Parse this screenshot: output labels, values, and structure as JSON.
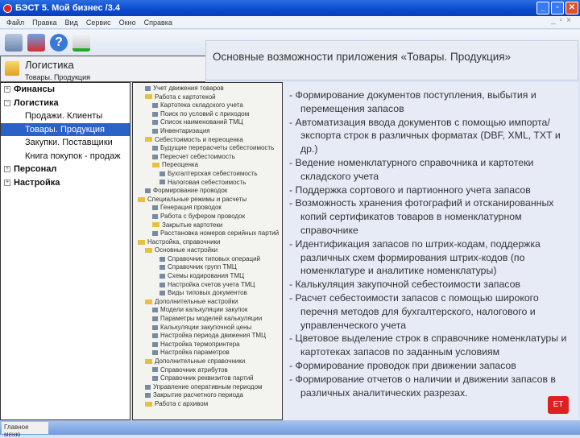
{
  "window": {
    "title": "БЭСТ 5. Мой бизнес /3.4",
    "buttons": [
      "_",
      "▫",
      "✕"
    ]
  },
  "menu": [
    "Файл",
    "Правка",
    "Вид",
    "Сервис",
    "Окно",
    "Справка"
  ],
  "callout": "Основные возможности приложения «Товары. Продукция»",
  "module": {
    "title": "Логистика",
    "subtitle": "Товары. Продукция"
  },
  "nav": [
    {
      "label": "Финансы",
      "level": 0,
      "pm": "+"
    },
    {
      "label": "Логистика",
      "level": 0,
      "pm": "−"
    },
    {
      "label": "Продажи. Клиенты",
      "level": 1
    },
    {
      "label": "Товары. Продукция",
      "level": 1,
      "selected": true
    },
    {
      "label": "Закупки. Поставщики",
      "level": 1
    },
    {
      "label": "Книга покупок - продаж",
      "level": 1
    },
    {
      "label": "Персонал",
      "level": 0,
      "pm": "+"
    },
    {
      "label": "Настройка",
      "level": 0,
      "pm": "+"
    }
  ],
  "tree": [
    {
      "t": "Учет движения товаров",
      "l": 1
    },
    {
      "t": "Работа с картотекой",
      "l": 1,
      "f": 1
    },
    {
      "t": "Картотека складского учета",
      "l": 2
    },
    {
      "t": "Поиск по условий с приходом",
      "l": 2
    },
    {
      "t": "Список наименований ТМЦ",
      "l": 2
    },
    {
      "t": "Инвентаризация",
      "l": 2
    },
    {
      "t": "Себестоимость и переоценка",
      "l": 1,
      "f": 1
    },
    {
      "t": "Будущие перерасчеты себестоимость",
      "l": 2
    },
    {
      "t": "Пересчет себестоимость",
      "l": 2
    },
    {
      "t": "Переоценка",
      "l": 2,
      "f": 1
    },
    {
      "t": "Бухгалтерская себестоимость",
      "l": 3
    },
    {
      "t": "Налоговая себестоимость",
      "l": 3
    },
    {
      "t": "Формирование проводок",
      "l": 1
    },
    {
      "t": "Специальные режимы и расчеты",
      "l": 0,
      "f": 1
    },
    {
      "t": "Генерация проводок",
      "l": 2
    },
    {
      "t": "Работа с буфером проводок",
      "l": 2
    },
    {
      "t": "Закрытые картотеки",
      "l": 2,
      "f": 1
    },
    {
      "t": "Расстановка номеров серийных партий",
      "l": 2
    },
    {
      "t": "Настройка, справочники",
      "l": 0,
      "f": 1
    },
    {
      "t": "Основные настройки",
      "l": 1,
      "f": 1
    },
    {
      "t": "Справочник типовых операций",
      "l": 3
    },
    {
      "t": "Справочник групп ТМЦ",
      "l": 3
    },
    {
      "t": "Схемы кодирования ТМЦ",
      "l": 3
    },
    {
      "t": "Настройка счетов учета ТМЦ",
      "l": 3
    },
    {
      "t": "Виды типовых документов",
      "l": 3
    },
    {
      "t": "Дополнительные настройки",
      "l": 1,
      "f": 1
    },
    {
      "t": "Модели калькуляции закупок",
      "l": 2
    },
    {
      "t": "Параметры моделей калькуляции",
      "l": 2
    },
    {
      "t": "Калькуляции закупочной цены",
      "l": 2
    },
    {
      "t": "Настройка периода движения ТМЦ",
      "l": 2
    },
    {
      "t": "Настройка термопринтера",
      "l": 2
    },
    {
      "t": "Настройка параметров",
      "l": 2
    },
    {
      "t": "Дополнительные справочники",
      "l": 1,
      "f": 1
    },
    {
      "t": "Справочник атрибутов",
      "l": 2
    },
    {
      "t": "Справочник реквизитов партий",
      "l": 2
    },
    {
      "t": "Управление оперативным периодом",
      "l": 1
    },
    {
      "t": "Закрытие расчетного периода",
      "l": 1
    },
    {
      "t": "Работа с архивом",
      "l": 1,
      "f": 1
    }
  ],
  "features": [
    "- Формирование документов поступления, выбытия и перемещения запасов",
    "- Автоматизация ввода документов с помощью импорта/экспорта строк в различных форматах (DBF, XML, TXT и др.)",
    "- Ведение номенклатурного справочника и картотеки складского учета",
    "- Поддержка сортового и партионного учета запасов",
    "- Возможность хранения фотографий и отсканированных копий сертификатов товаров в номенклатурном справочнике",
    "- Идентификация запасов по штрих-кодам, поддержка различных схем формирования штрих-кодов (по номенклатуре и аналитике номенклатуры)",
    "- Калькуляция закупочной себестоимости запасов",
    "- Расчет себестоимости запасов с помощью широкого перечня методов для бухгалтерского, налогового и управленческого учета",
    "- Цветовое выделение строк в справочнике номенклатуры и картотеках запасов по заданным условиям",
    "- Формирование проводок при движении запасов",
    "- Формирование отчетов о наличии и движении запасов в различных аналитических разрезах."
  ],
  "badge": "ЕТ",
  "taskbar": {
    "button": "Главное меню"
  }
}
